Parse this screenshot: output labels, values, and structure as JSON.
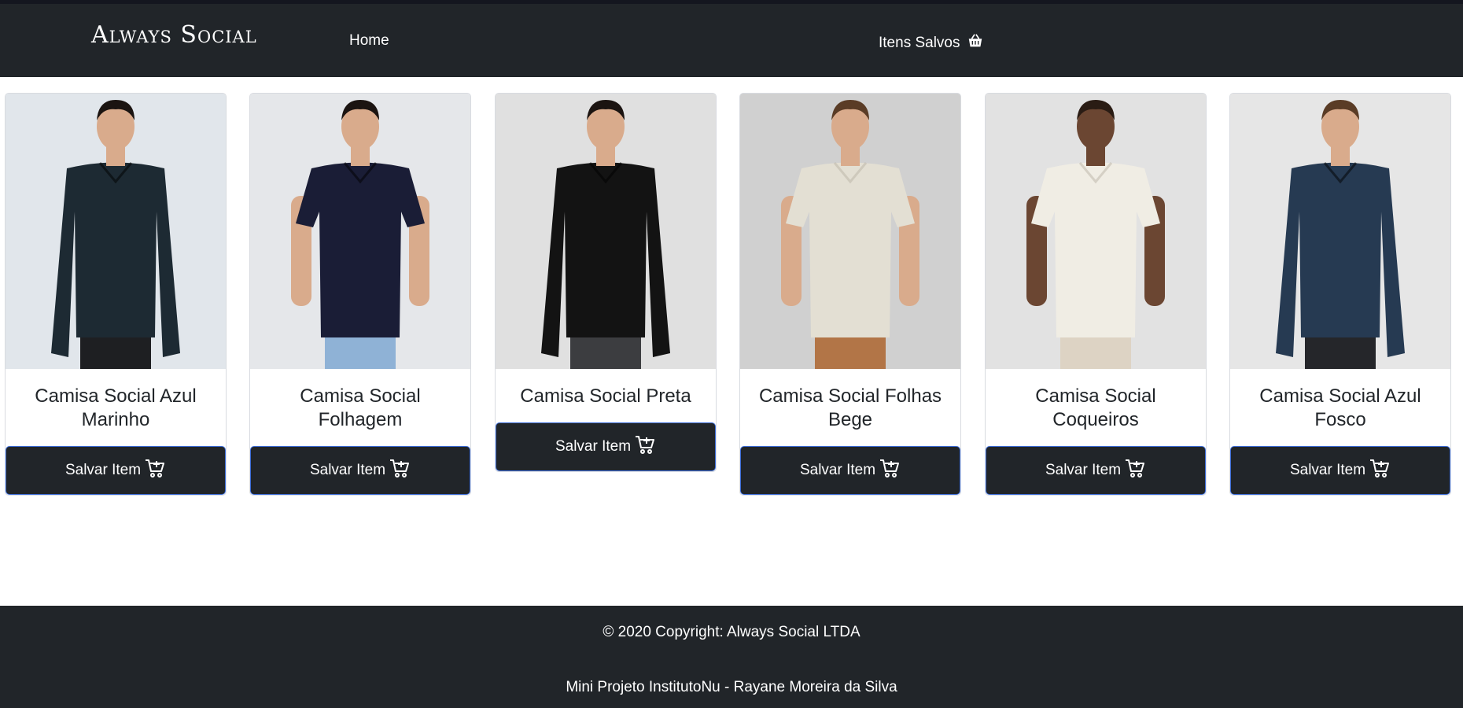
{
  "brand": {
    "name": "Always Social"
  },
  "nav": {
    "home_label": "Home",
    "saved_label": "Itens Salvos",
    "saved_icon": "basket-icon"
  },
  "products": [
    {
      "title": "Camisa Social Azul Marinho",
      "button_label": "Salvar Item",
      "shirt_color": "#1d2a33",
      "bg_color": "#e1e6eb",
      "pants_color": "#1e1f22"
    },
    {
      "title": "Camisa Social Folhagem",
      "button_label": "Salvar Item",
      "shirt_color": "#1a1d36",
      "bg_color": "#e5e7ea",
      "pants_color": "#8fb2d6"
    },
    {
      "title": "Camisa Social Preta",
      "button_label": "Salvar Item",
      "shirt_color": "#131313",
      "bg_color": "#e0e0e0",
      "pants_color": "#3c3d40"
    },
    {
      "title": "Camisa Social Folhas Bege",
      "button_label": "Salvar Item",
      "shirt_color": "#e3dfd3",
      "bg_color": "#d0d0d0",
      "pants_color": "#b27547"
    },
    {
      "title": "Camisa Social Coqueiros",
      "button_label": "Salvar Item",
      "shirt_color": "#f0ede4",
      "bg_color": "#e2e2e2",
      "pants_color": "#ddd3c4"
    },
    {
      "title": "Camisa Social Azul Fosco",
      "button_label": "Salvar Item",
      "shirt_color": "#263a52",
      "bg_color": "#e6e6e6",
      "pants_color": "#25262a"
    }
  ],
  "footer": {
    "copyright": "© 2020 Copyright: Always Social LTDA",
    "credit": "Mini Projeto InstitutoNu - Rayane Moreira da Silva"
  },
  "colors": {
    "navbar": "#212529",
    "button_border": "#3b6bd6"
  }
}
